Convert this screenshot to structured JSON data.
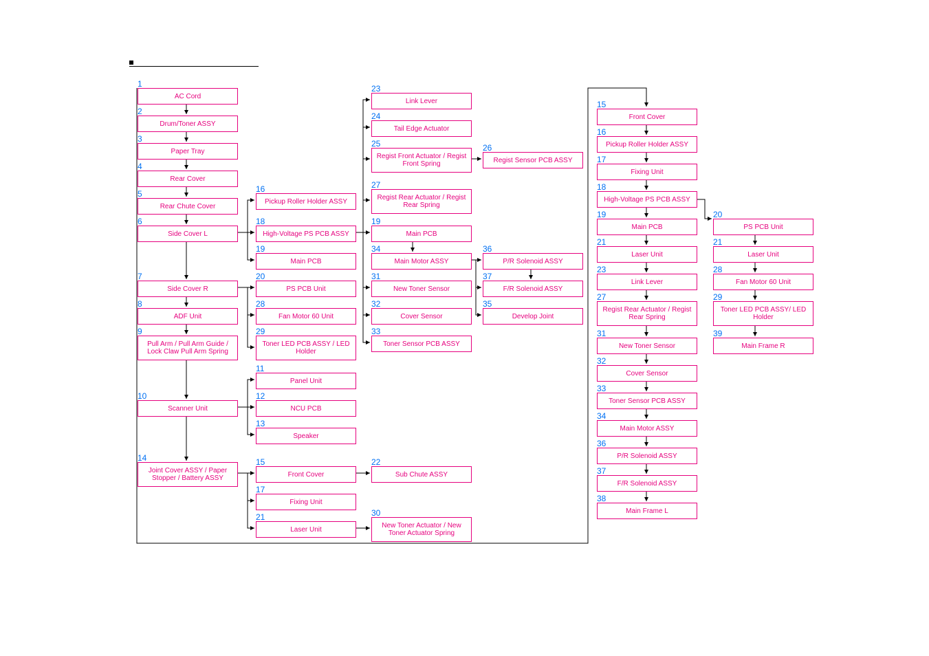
{
  "col1": {
    "n1": "1",
    "b1": "AC Cord",
    "n2": "2",
    "b2": "Drum/Toner ASSY",
    "n3": "3",
    "b3": "Paper Tray",
    "n4": "4",
    "b4": "Rear Cover",
    "n5": "5",
    "b5": "Rear Chute Cover",
    "n6": "6",
    "b6": "Side Cover L",
    "n7": "7",
    "b7": "Side Cover R",
    "n8": "8",
    "b8": "ADF Unit",
    "n9": "9",
    "b9": "Pull Arm / Pull Arm Guide / Lock Claw Pull Arm Spring",
    "n10": "10",
    "b10": "Scanner Unit",
    "n14": "14",
    "b14": "Joint Cover ASSY / Paper Stopper / Battery ASSY"
  },
  "col2": {
    "n16": "16",
    "b16": "Pickup Roller Holder ASSY",
    "n18": "18",
    "b18": "High-Voltage PS PCB ASSY",
    "n19": "19",
    "b19": "Main PCB",
    "n20": "20",
    "b20": "PS PCB Unit",
    "n28": "28",
    "b28": "Fan Motor 60 Unit",
    "n29": "29",
    "b29": "Toner LED PCB ASSY / LED Holder",
    "n11": "11",
    "b11": "Panel Unit",
    "n12": "12",
    "b12": "NCU PCB",
    "n13": "13",
    "b13": "Speaker",
    "n15": "15",
    "b15": "Front Cover",
    "n17": "17",
    "b17": "Fixing Unit",
    "n21": "21",
    "b21": "Laser Unit"
  },
  "col3": {
    "n23": "23",
    "b23": "Link Lever",
    "n24": "24",
    "b24": "Tail Edge Actuator",
    "n25": "25",
    "b25": "Regist Front Actuator / Regist Front Spring",
    "n27": "27",
    "b27": "Regist Rear Actuator / Regist Rear Spring",
    "n19b": "19",
    "b19b": "Main PCB",
    "n34": "34",
    "b34": "Main Motor ASSY",
    "n31": "31",
    "b31": "New Toner Sensor",
    "n32": "32",
    "b32": "Cover Sensor",
    "n33": "33",
    "b33": "Toner Sensor PCB ASSY",
    "n22": "22",
    "b22": "Sub Chute ASSY",
    "n30": "30",
    "b30": "New Toner Actuator / New Toner Actuator Spring"
  },
  "col4": {
    "n26": "26",
    "b26": "Regist Sensor PCB ASSY",
    "n36": "36",
    "b36": "P/R Solenoid ASSY",
    "n37": "37",
    "b37": "F/R Solenoid ASSY",
    "n35": "35",
    "b35": "Develop Joint"
  },
  "col5": {
    "n15": "15",
    "b15": "Front Cover",
    "n16": "16",
    "b16": "Pickup Roller Holder ASSY",
    "n17": "17",
    "b17": "Fixing Unit",
    "n18": "18",
    "b18": "High-Voltage PS PCB ASSY",
    "n19": "19",
    "b19": "Main PCB",
    "n21": "21",
    "b21": "Laser Unit",
    "n23": "23",
    "b23": "Link Lever",
    "n27": "27",
    "b27": "Regist Rear Actuator / Regist Rear Spring",
    "n31": "31",
    "b31": "New Toner Sensor",
    "n32": "32",
    "b32": "Cover Sensor",
    "n33": "33",
    "b33": "Toner Sensor PCB ASSY",
    "n34": "34",
    "b34": "Main Motor ASSY",
    "n36": "36",
    "b36": "P/R Solenoid ASSY",
    "n37": "37",
    "b37": "F/R Solenoid ASSY",
    "n38": "38",
    "b38": "Main Frame L"
  },
  "col6": {
    "n20": "20",
    "b20": "PS PCB Unit",
    "n21": "21",
    "b21": "Laser Unit",
    "n28": "28",
    "b28": "Fan Motor 60 Unit",
    "n29": "29",
    "b29": "Toner LED PCB ASSY/ LED Holder",
    "n39": "39",
    "b39": "Main Frame R"
  }
}
